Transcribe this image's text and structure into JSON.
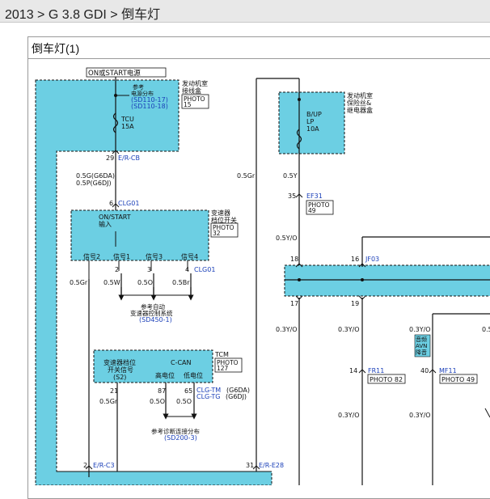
{
  "breadcrumb": {
    "year": "2013",
    "sep1": " > ",
    "model": "G 3.8 GDI",
    "sep2": " > ",
    "page": "倒车灯"
  },
  "panel_title": "倒车灯(1)",
  "diagram": {
    "power_label": "ON或START电源",
    "engine_box": {
      "line1": "发动机室",
      "line2": "接线盒"
    },
    "engine_ref": {
      "line1": "参考",
      "line2": "电源分布",
      "link1": "(SD110-17)",
      "link2": "(SD110-18)"
    },
    "photo_15": {
      "line1": "PHOTO",
      "line2": "15"
    },
    "tcu_fuse": {
      "line1": "TCU",
      "line2": "15A"
    },
    "conn_29": {
      "pin": "29",
      "code": "E/R-CB"
    },
    "wire_g6da": "0.5G(G6DA)",
    "wire_g6dj": "0.5P(G6DJ)",
    "conn_6": {
      "pin": "6",
      "code": "CLG01"
    },
    "trans_switch": {
      "line1": "ON/START",
      "line2": "输入"
    },
    "trans_label": {
      "line1": "变速器",
      "line2": "档位开关"
    },
    "photo_32": {
      "line1": "PHOTO",
      "line2": "32"
    },
    "signals": {
      "s2": "信号2",
      "s1": "信号1",
      "s3": "信号3",
      "s4": "信号4"
    },
    "pins_clg": {
      "p2": "2",
      "p3": "3",
      "p4": "4",
      "code": "CLG01"
    },
    "wires_mid": {
      "w1": "0.5Gr",
      "w2": "0.5W",
      "w3": "0.5O",
      "w4": "0.5Br"
    },
    "ref_auto": {
      "line1": "参考自动",
      "line2": "变速器控制系统",
      "link": "(SD450-1)"
    },
    "tcm_box": {
      "line1": "变速器档位",
      "line2": "开关信号",
      "line3": "(S2)",
      "ccan": "C-CAN",
      "hi": "高电位",
      "lo": "低电位"
    },
    "tcm_label": "TCM",
    "photo_127": {
      "line1": "PHOTO",
      "line2": "127"
    },
    "tcm_pins": {
      "p21": "21",
      "p87": "87",
      "p65": "65"
    },
    "clg_tm": {
      "code": "CLG-TM",
      "suffix": "(G6DA)"
    },
    "clg_tg": {
      "code": "CLG-TG",
      "suffix": "(G6DJ)"
    },
    "wires_low": {
      "w1": "0.5Gr",
      "w2": "0.5O",
      "w3": "0.5O"
    },
    "ref_diag": {
      "line1": "参考诊断连接分布",
      "link": "(SD200-3)"
    },
    "conn_2": {
      "pin": "2",
      "code": "E/R-C3"
    },
    "conn_31": {
      "pin": "31",
      "code": "E/R-E28"
    },
    "wire_gr_upper": "0.5Gr",
    "bup_box": {
      "line1": "发动机室",
      "line2": "保险丝&",
      "line3": "继电器盒"
    },
    "bup_fuse": {
      "line1": "B/UP",
      "line2": "LP",
      "line3": "10A"
    },
    "wire_05y": "0.5Y",
    "ef31": {
      "pin": "35",
      "code": "EF31"
    },
    "photo_49a": {
      "line1": "PHOTO",
      "line2": "49"
    },
    "wire_05yo": "0.5Y/O",
    "jf03": {
      "p18": "18",
      "p16": "16",
      "code": "JF03",
      "p17": "17",
      "p19": "19"
    },
    "wires_yo": {
      "w1": "0.3Y/O",
      "w2": "0.3Y/O",
      "w3": "0.3Y/O",
      "w4": "0.5"
    },
    "avn_box": {
      "line1": "音频",
      "line2": "AVN",
      "line3": "降音"
    },
    "fr11": {
      "pin": "14",
      "code": "FR11"
    },
    "photo_82": "PHOTO 82",
    "mf11": {
      "pin": "40",
      "code": "MF11"
    },
    "photo_49b": "PHOTO 49",
    "wires_yo2": {
      "w1": "0.3Y/O",
      "w2": "0.3Y/O"
    }
  },
  "colors": {
    "fill": "#6ccfe3",
    "link": "#1a3fb8",
    "stroke": "#111111",
    "crumb_bg": "#e8e8e8"
  }
}
